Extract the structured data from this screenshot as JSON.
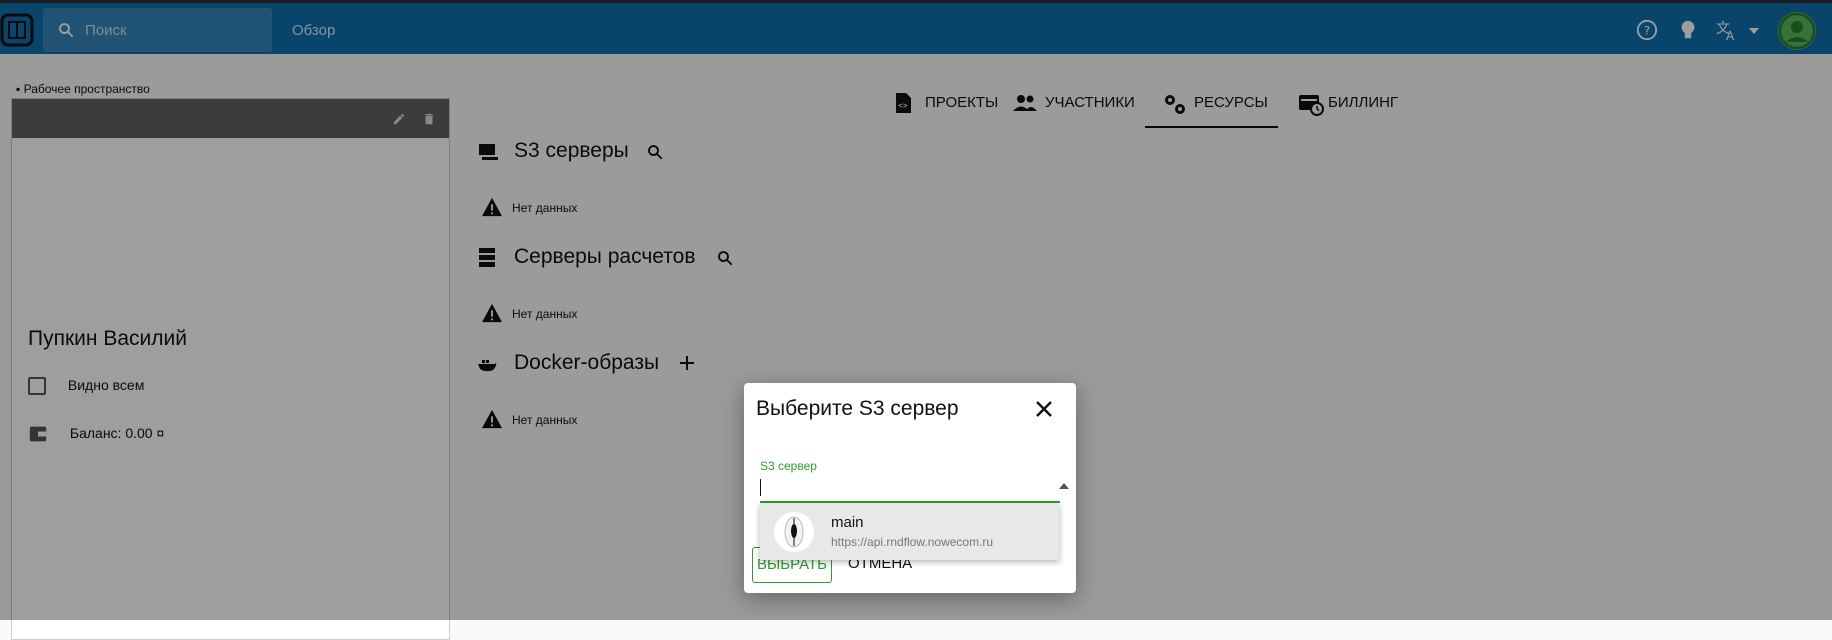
{
  "topbar": {
    "search_placeholder": "Поиск",
    "overview_label": "Обзор"
  },
  "workspace": {
    "label": "Рабочее пространство",
    "owner_name": "Пупкин Василий",
    "visibility_label": "Видно всем",
    "balance_label": "Баланс: 0.00 ¤"
  },
  "tabs": [
    {
      "label": "ПРОЕКТЫ"
    },
    {
      "label": "УЧАСТНИКИ"
    },
    {
      "label": "РЕСУРСЫ"
    },
    {
      "label": "БИЛЛИНГ"
    }
  ],
  "sections": [
    {
      "title": "S3 серверы",
      "empty": "Нет данных"
    },
    {
      "title": "Серверы расчетов",
      "empty": "Нет данных"
    },
    {
      "title": "Docker-образы",
      "empty": "Нет данных"
    }
  ],
  "dialog": {
    "title": "Выберите S3 сервер",
    "field_label": "S3 сервер",
    "option_name": "main",
    "option_url": "https://api.rndflow.nowecom.ru",
    "select_label": "ВЫБРАТЬ",
    "cancel_label": "ОТМЕНА"
  },
  "colors": {
    "topbar": "#0f6fb0",
    "accent": "#2e9c2e"
  }
}
